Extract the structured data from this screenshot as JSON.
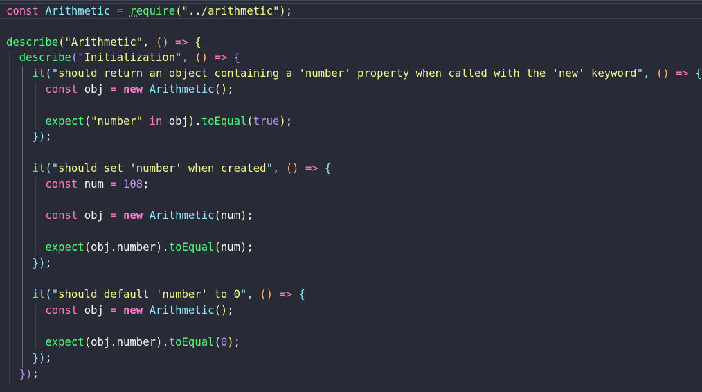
{
  "editor": {
    "language": "javascript",
    "theme": "dark",
    "colors": {
      "background": "#282a36",
      "keyword": "#ff79c6",
      "class": "#8be9fd",
      "function": "#50fa7b",
      "string": "#f1fa8c",
      "number": "#bd93f9",
      "text": "#f8f8f2"
    },
    "tokens": {
      "const": "const",
      "new": "new",
      "in": "in",
      "true": "true",
      "Arithmetic": "Arithmetic",
      "require": "require",
      "describe": "describe",
      "it": "it",
      "expect": "expect",
      "toEqual": "toEqual",
      "obj": "obj",
      "num": "num",
      "number": "number",
      "eq": "=",
      "arrow": "=>",
      "dot": ".",
      "comma": ",",
      "semi": ";",
      "lparen": "(",
      "rparen": ")",
      "lbrace": "{",
      "rbrace": "}",
      "lp_str": "(\"",
      "str_rp": "\")",
      "str_comma": "\",",
      "s_arith_path": "../arithmetic",
      "s_Arithmetic": "Arithmetic",
      "s_Init": "Initialization",
      "s_test1": "should return an object containing a 'number' property when called with the 'new' keyword",
      "s_test2": "should set 'number' when created",
      "s_test3": "should default 'number' to 0",
      "s_number_q": "\"number\"",
      "v108": "108",
      "v0": "0"
    }
  }
}
